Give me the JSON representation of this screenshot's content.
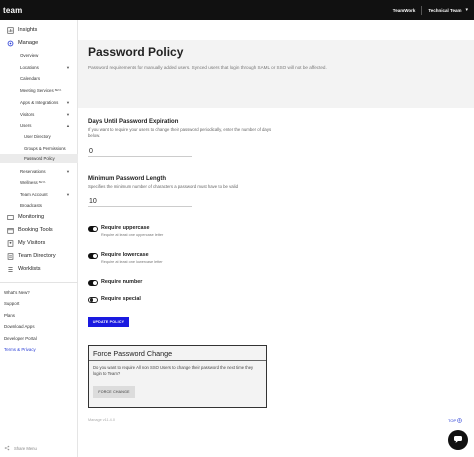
{
  "topbar": {
    "logo": "team",
    "account": "TeamWork",
    "team": "Technical Team"
  },
  "sidebar": {
    "items": [
      {
        "label": "Insights",
        "icon": "insights-icon"
      },
      {
        "label": "Manage",
        "icon": "gear-icon"
      },
      {
        "label": "Overview"
      },
      {
        "label": "Locations"
      },
      {
        "label": "Calendars"
      },
      {
        "label": "Meeting Services",
        "badge": "BETA"
      },
      {
        "label": "Apps & Integrations"
      },
      {
        "label": "Visitors"
      },
      {
        "label": "Users"
      },
      {
        "label": "User Directory"
      },
      {
        "label": "Groups & Permissions"
      },
      {
        "label": "Password Policy"
      },
      {
        "label": "Reservations"
      },
      {
        "label": "Wellness",
        "badge": "BETA"
      },
      {
        "label": "Team Account"
      },
      {
        "label": "Broadcasts"
      },
      {
        "label": "Monitoring",
        "icon": "monitoring-icon"
      },
      {
        "label": "Booking Tools",
        "icon": "booking-tools-icon"
      },
      {
        "label": "My Visitors",
        "icon": "visitors-icon"
      },
      {
        "label": "Team Directory",
        "icon": "directory-icon"
      },
      {
        "label": "Worklists",
        "icon": "worklists-icon"
      }
    ],
    "footer": [
      "What's New?",
      "Support",
      "Plans",
      "Download Apps",
      "Developer Portal",
      "Terms & Privacy"
    ],
    "share_menu": "Share Menu"
  },
  "page": {
    "title": "Password Policy",
    "description": "Password requirements for manually added users. Synced users that login through SAML or SSO will not be affected."
  },
  "expiration": {
    "title": "Days Until Password Expiration",
    "description": "If you want to require your users to change their password periodically, enter the number of days below.",
    "value": "0"
  },
  "min_length": {
    "title": "Minimum Password Length",
    "description": "Specifies the minimum number of characters a password must have to be valid",
    "value": "10"
  },
  "toggles": [
    {
      "label": "Require uppercase",
      "hint": "Require at least one uppercase letter",
      "on": true
    },
    {
      "label": "Require lowercase",
      "hint": "Require at least one lowercase letter",
      "on": true
    },
    {
      "label": "Require number",
      "hint": "",
      "on": true
    },
    {
      "label": "Require special",
      "hint": "",
      "on": false
    }
  ],
  "update_button": "UPDATE POLICY",
  "force": {
    "title": "Force Password Change",
    "description": "Do you want to require All non SSO Users to change their password the next time they login to Team?",
    "button": "FORCE CHANGE"
  },
  "version": "Manage v11.4.0",
  "top_link": "TOP",
  "colors": {
    "topbar": "#111111",
    "primary_button": "#1a1ae0",
    "link": "#2b3fd6",
    "header_band": "#f3f3f3"
  }
}
